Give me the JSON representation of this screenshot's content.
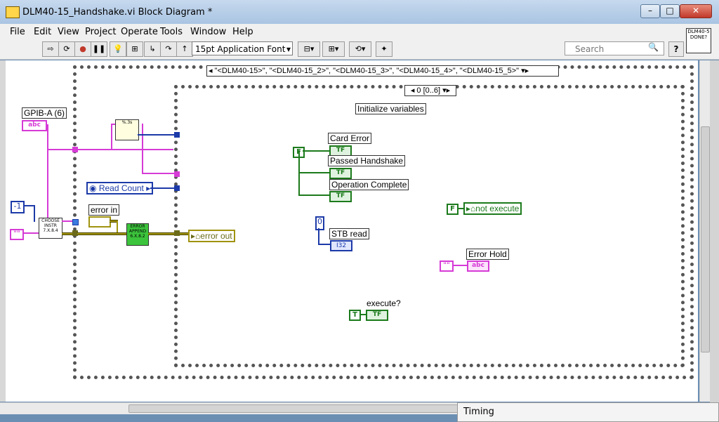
{
  "window": {
    "title": "DLM40-15_Handshake.vi Block Diagram *"
  },
  "menu": [
    "File",
    "Edit",
    "View",
    "Project",
    "Operate",
    "Tools",
    "Window",
    "Help"
  ],
  "toolbar": {
    "font": "15pt Application Font",
    "search_placeholder": "Search",
    "help": "?",
    "vi_icon_text": "DLM40-5 DONE?"
  },
  "diagram": {
    "case_selector": "\"<DLM40-15>\", \"<DLM40-15_2>\", \"<DLM40-15_3>\", \"<DLM40-15_4>\", \"<DLM40-15_5>\"",
    "sequence_selector": "0 [0..6]",
    "sequence_label": "Initialize variables",
    "gpib_label": "GPIB-A (6)",
    "gpib_const": "abc",
    "read_count": "Read Count",
    "minus_one": "-1",
    "empty_string": "\"\"",
    "error_in": "error in",
    "error_out": "error out",
    "choose_instr": "CHOOSE INSTR 7.X.8.4",
    "error_append": "ERROR APPEND 6.X.8.2",
    "format_node": "%.3s",
    "card_error": "Card Error",
    "passed_handshake": "Passed Handshake",
    "operation_complete": "Operation Complete",
    "false_const": "F",
    "true_const": "T",
    "tf": "TF",
    "not_execute": "not execute",
    "zero": "0",
    "stb_read": "STB read",
    "i32": "I32",
    "error_hold": "Error Hold",
    "abc": "abc",
    "execute": "execute?"
  },
  "timing": "Timing"
}
